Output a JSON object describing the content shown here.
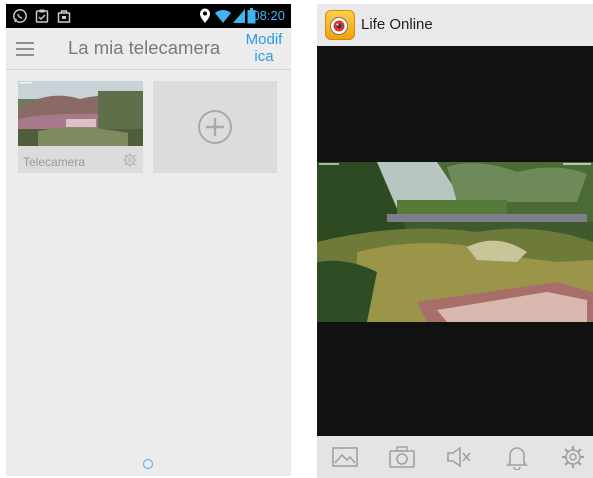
{
  "left_screen": {
    "status_bar": {
      "time": "08:20",
      "left_icons": [
        "whatsapp-icon",
        "clipboard-check-icon",
        "shopping-bag-icon"
      ],
      "right_icons": [
        "location-pin-icon",
        "wifi-icon",
        "signal-icon",
        "battery-icon"
      ]
    },
    "header": {
      "menu_icon": "hamburger-menu-icon",
      "title": "La mia telecamera",
      "edit_label_line1": "Modif",
      "edit_label_line2": "ica"
    },
    "cameras": [
      {
        "name": "Telecamera",
        "settings_icon": "gear-icon"
      }
    ],
    "add_camera_icon": "plus-circle-icon"
  },
  "right_screen": {
    "app_title": "Life Online",
    "app_icon": "app-logo-icon",
    "toolbar": [
      "gallery-icon",
      "camera-icon",
      "mute-speaker-icon",
      "bell-icon",
      "gear-icon"
    ]
  },
  "colors": {
    "status_bar": "#000000",
    "accent_blue": "#2a9ae8",
    "screen_background": "#ececec",
    "video_background": "#111111"
  }
}
